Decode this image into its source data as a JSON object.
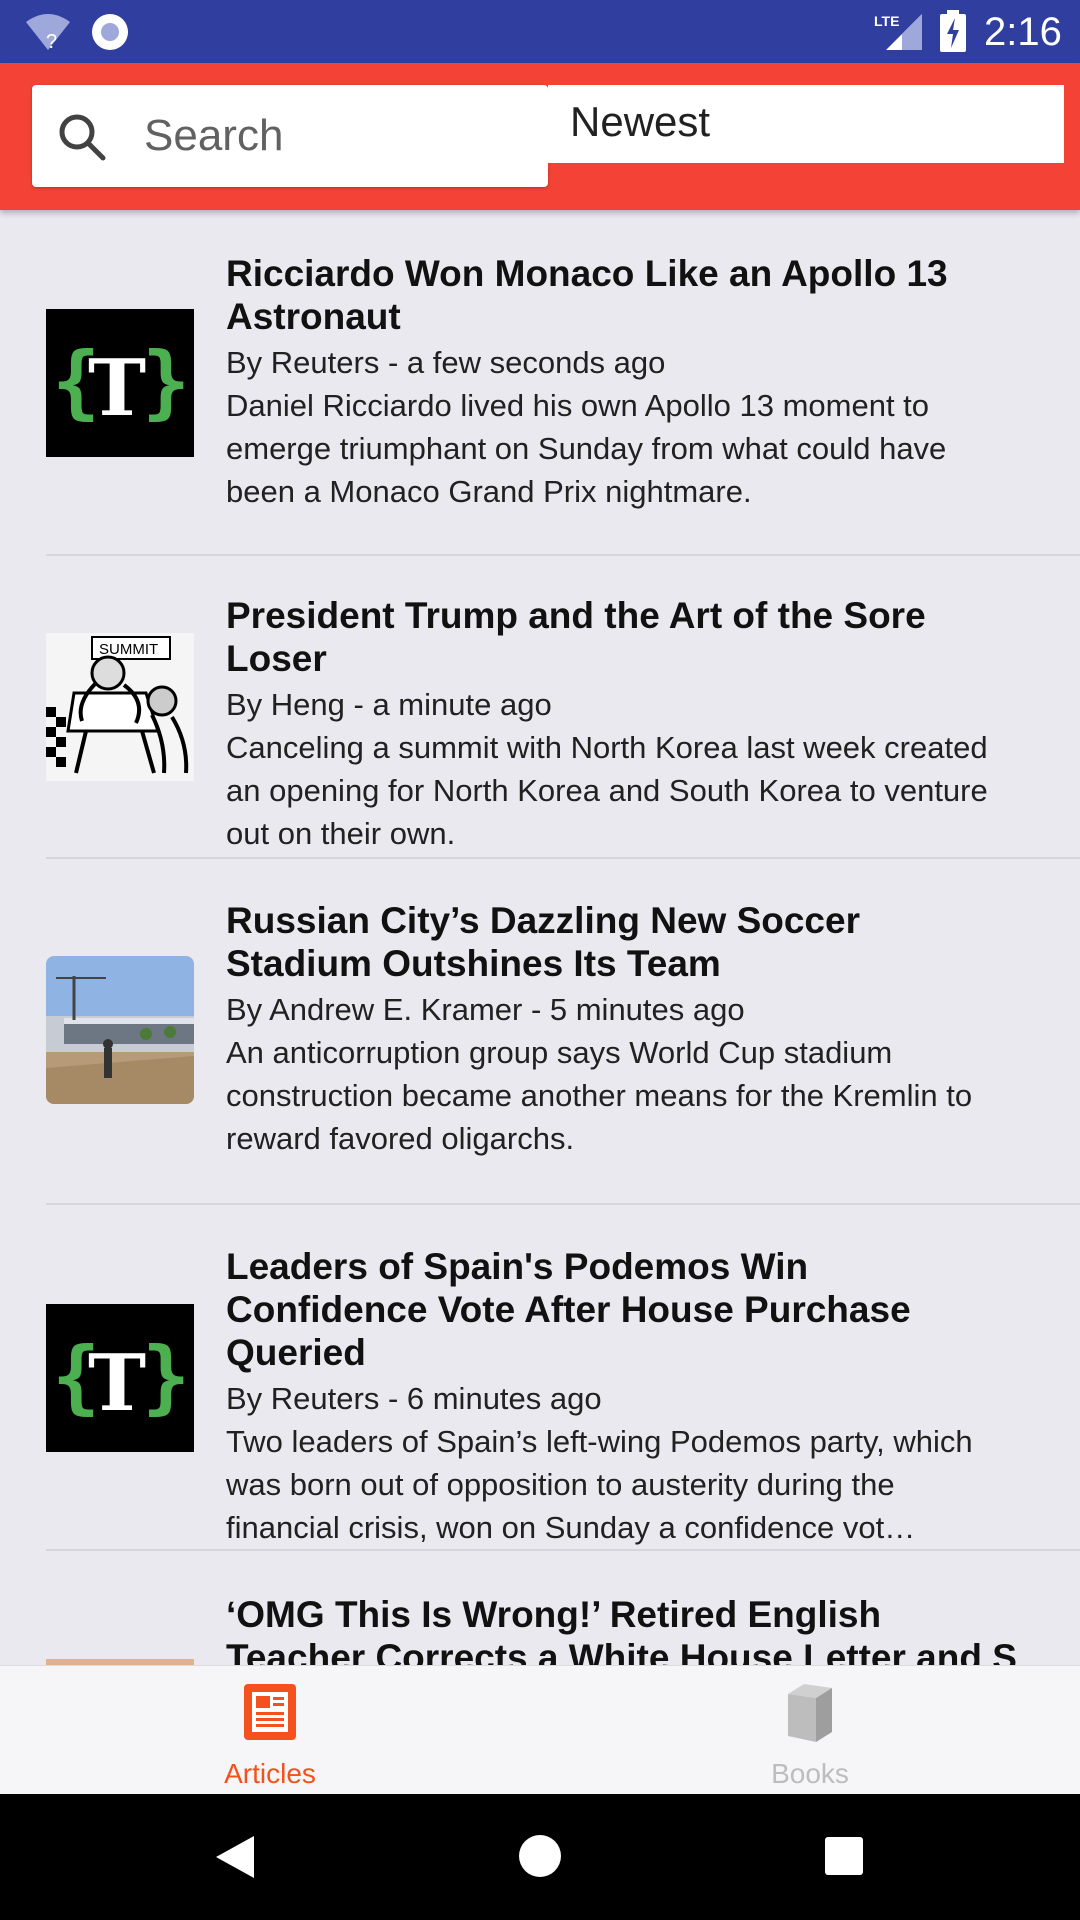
{
  "status_bar": {
    "time": "2:16",
    "network": "LTE",
    "icons": [
      "wifi-question-icon",
      "sync-circle-icon",
      "lte-signal-icon",
      "battery-charging-icon"
    ]
  },
  "toolbar": {
    "search_placeholder": "Search",
    "sort_value": "Newest",
    "accent_color": "#f44336"
  },
  "articles": [
    {
      "title": "Ricciardo Won Monaco Like an Apollo 13 Astronaut",
      "byline": "By Reuters - a few seconds ago",
      "summary": "Daniel Ricciardo lived his own Apollo 13 moment to emerge  triumphant on Sunday from what could have been a Monaco Grand Prix nightmare.",
      "thumbnail": "nyt-logo-icon"
    },
    {
      "title": "President Trump and the Art of the Sore Loser",
      "byline": "By Heng - a minute ago",
      "summary": "Canceling a summit with North Korea last week created an opening for North Korea and South Korea to venture out on their own.",
      "thumbnail": "summit-cartoon-image",
      "thumb_caption": "SUMMIT"
    },
    {
      "title": "Russian City’s Dazzling New Soccer Stadium Outshines Its Team",
      "byline": "By Andrew E. Kramer - 5 minutes ago",
      "summary": "An anticorruption group says World Cup stadium construction became another means for the Kremlin to reward favored oligarchs.",
      "thumbnail": "stadium-photo-image"
    },
    {
      "title": "Leaders of Spain's Podemos Win Confidence Vote After House Purchase Queried",
      "byline": "By Reuters - 6 minutes ago",
      "summary": "Two leaders of Spain’s left-wing Podemos party, which was born out of opposition to austerity during the financial crisis, won on Sunday a confidence vot…",
      "thumbnail": "nyt-logo-icon"
    },
    {
      "title": "‘OMG This Is Wrong!’ Retired English Teacher Corrects a White House Letter and S",
      "thumbnail": "letter-photo-image"
    }
  ],
  "bottom_nav": {
    "items": [
      {
        "label": "Articles",
        "icon": "article-icon",
        "active": true,
        "color": "#f4511e"
      },
      {
        "label": "Books",
        "icon": "book-icon",
        "active": false,
        "color": "#bdbdbd"
      }
    ]
  },
  "system_nav": {
    "icons": [
      "back-icon",
      "home-icon",
      "recents-icon"
    ]
  }
}
